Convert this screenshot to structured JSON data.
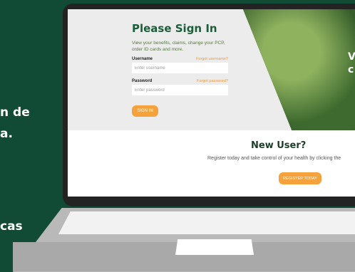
{
  "background_text": {
    "line1": "n de",
    "line2": "a.",
    "line3": "cas"
  },
  "photo_text": {
    "line1": "V",
    "line2": "c"
  },
  "signin": {
    "title": "Please Sign In",
    "description": "View your benefits, claims, change your PCP, order ID cards and more.",
    "username_label": "Username",
    "forgot_username": "Forgot username?",
    "username_placeholder": "Enter username",
    "password_label": "Password",
    "forgot_password": "Forgot password?",
    "password_placeholder": "Enter password",
    "button": "SIGN IN"
  },
  "new_user": {
    "title": "New User?",
    "text": "Register today and take control of your health by clicking the",
    "button": "REGISTER TODAY"
  },
  "colors": {
    "page_bg": "#124b35",
    "brand_green": "#1d5e3a",
    "accent_orange": "#f5a23c"
  }
}
